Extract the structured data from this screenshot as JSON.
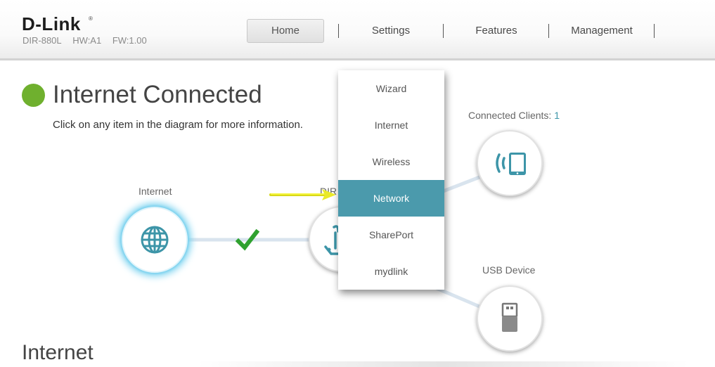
{
  "header": {
    "brand": "D-Link",
    "model": "DIR-880L",
    "hw": "HW:A1",
    "fw": "FW:1.00"
  },
  "nav": {
    "home": "Home",
    "settings": "Settings",
    "features": "Features",
    "management": "Management"
  },
  "settings_menu": {
    "items": [
      "Wizard",
      "Internet",
      "Wireless",
      "Network",
      "SharePort",
      "mydlink"
    ],
    "highlighted": "Network"
  },
  "status": {
    "title": "Internet Connected",
    "instruction": "Click on any item in the diagram for more information.",
    "indicator_color": "#6fb02e"
  },
  "diagram": {
    "internet_label": "Internet",
    "router_label": "DIR",
    "clients_label": "Connected Clients:",
    "clients_count": "1",
    "usb_label": "USB Device",
    "link_status": "connected"
  },
  "section": {
    "title": "Internet"
  },
  "colors": {
    "accent": "#4b9aac",
    "icon": "#3d95a8",
    "check": "#2fa12f",
    "glow": "#7fd4f0",
    "annotation_arrow": "#f2f21c"
  },
  "icons": {
    "internet": "globe-icon",
    "router": "router-icon",
    "clients": "wireless-tablet-icon",
    "usb": "usb-drive-icon",
    "link": "checkmark-icon"
  }
}
